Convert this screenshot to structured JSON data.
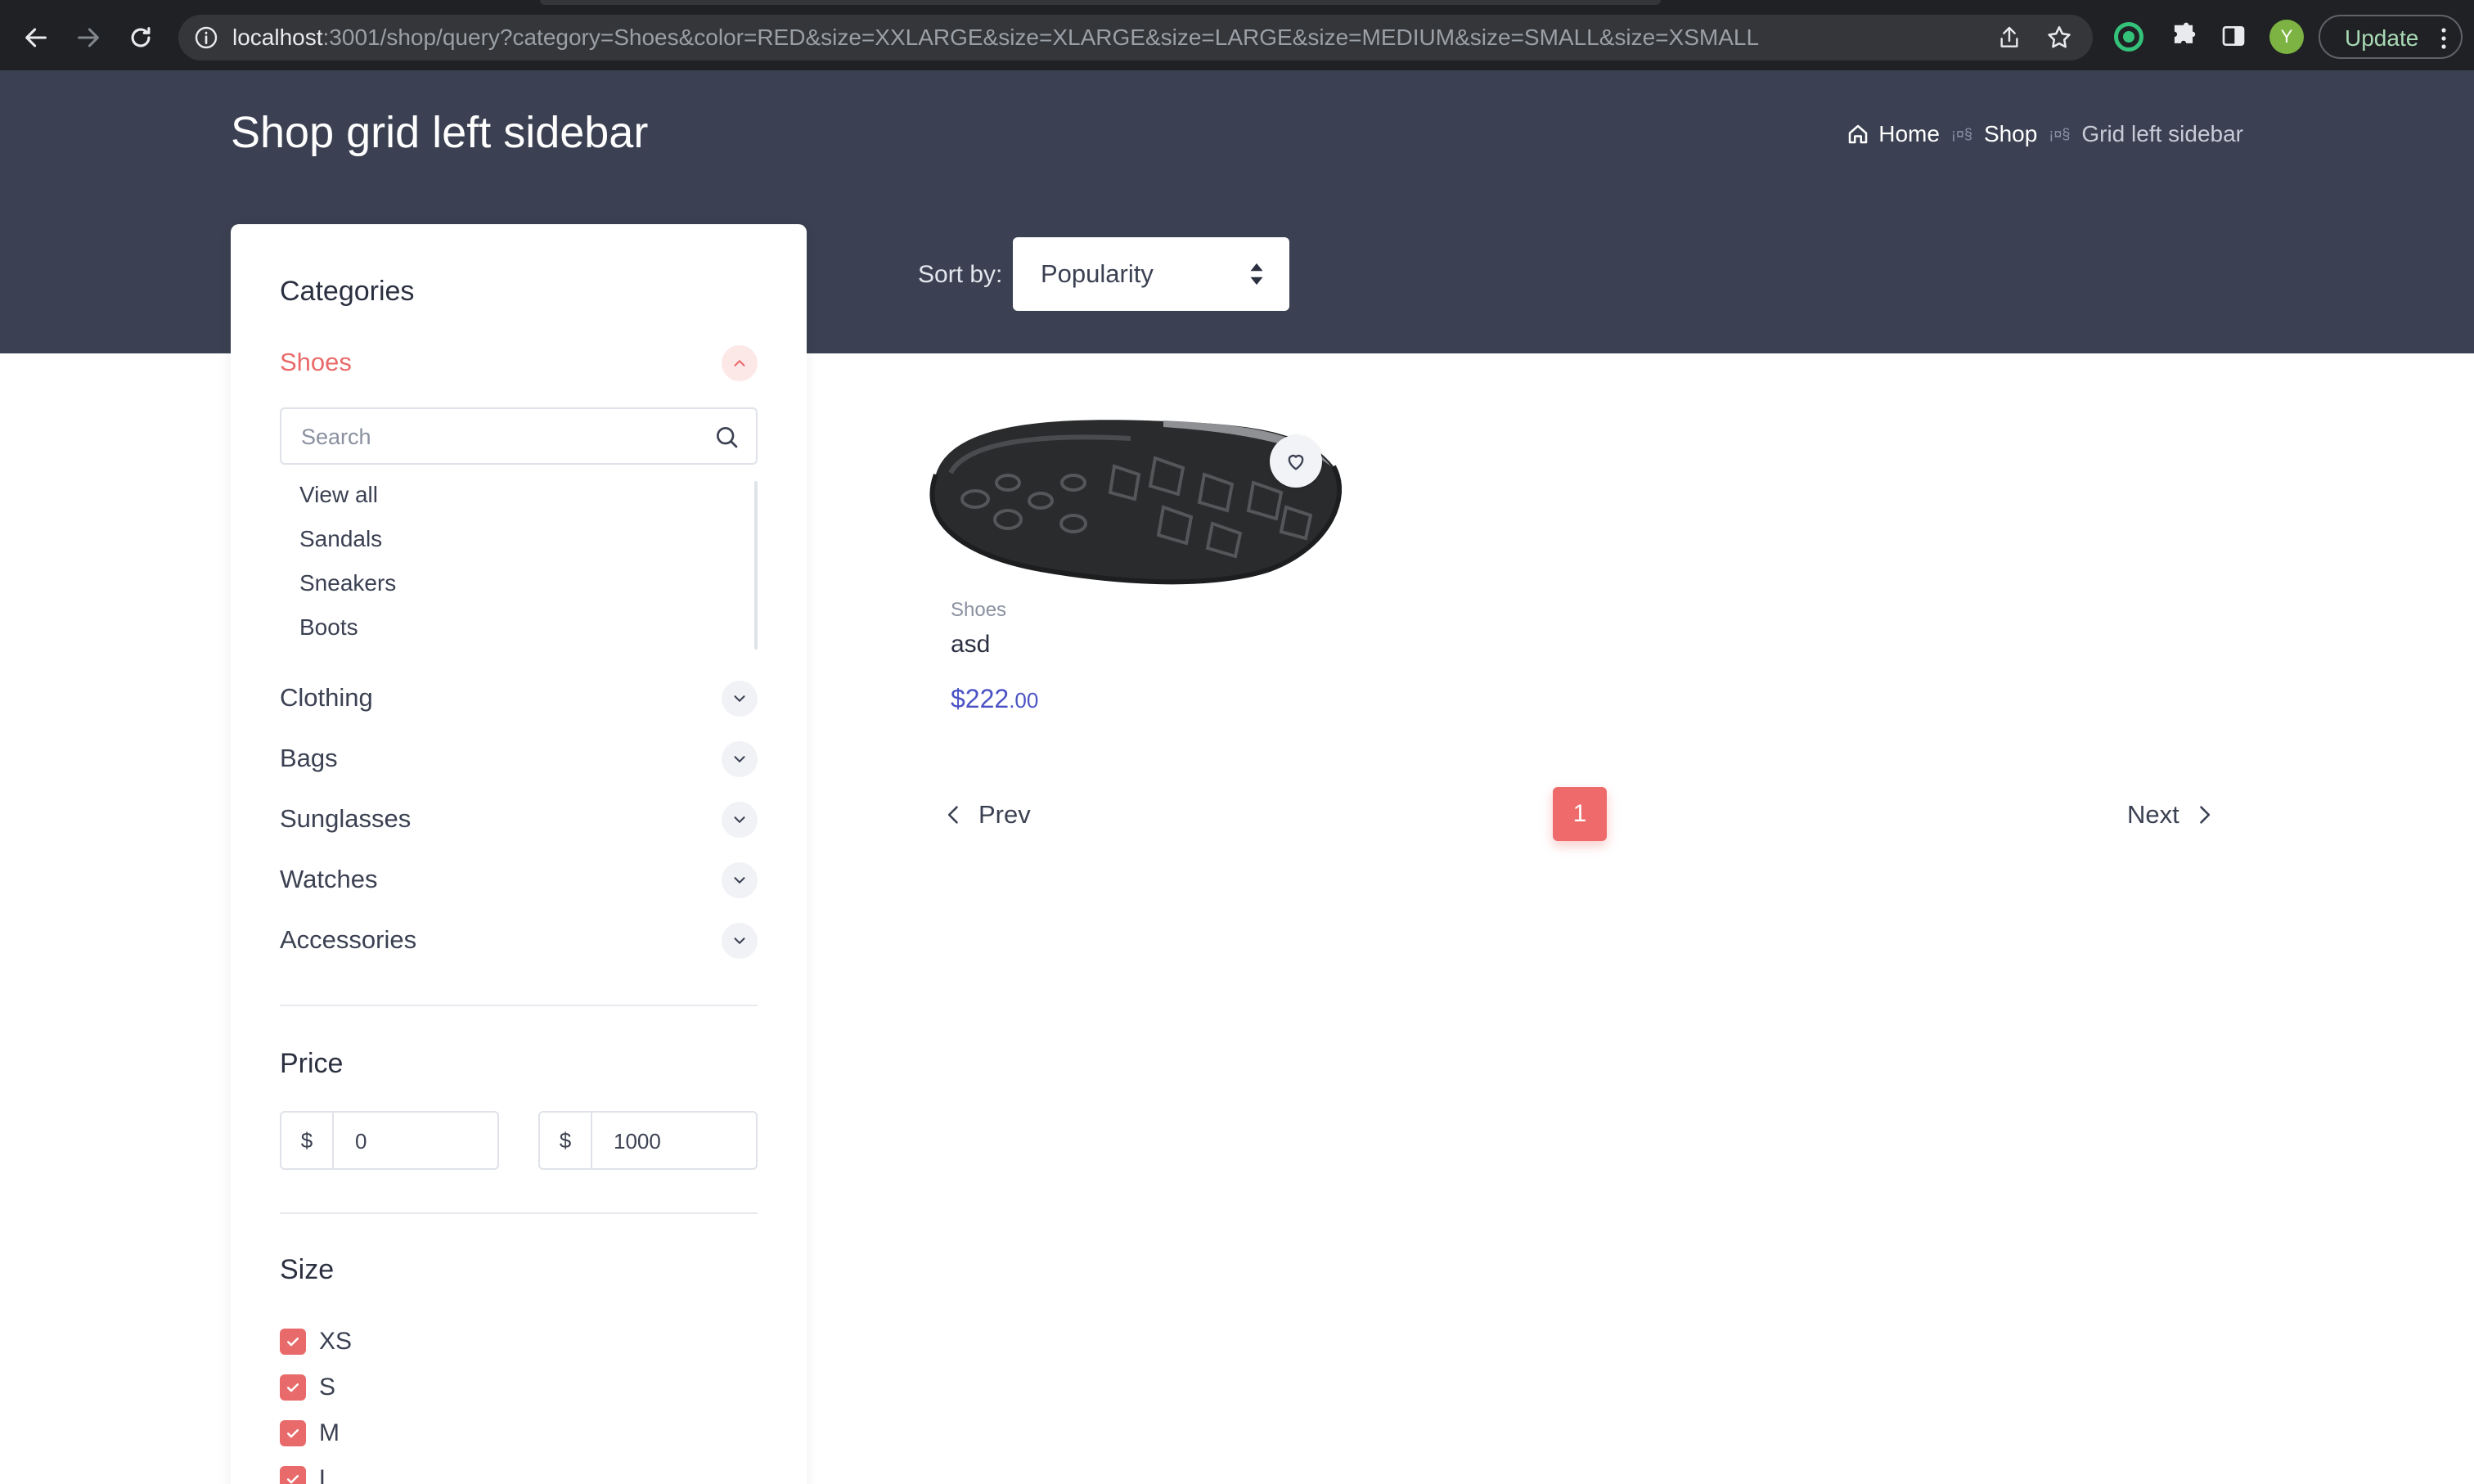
{
  "browser": {
    "url_host": "localhost",
    "url_rest": ":3001/shop/query?category=Shoes&color=RED&size=XXLARGE&size=XLARGE&size=LARGE&size=MEDIUM&size=SMALL&size=XSMALL",
    "profile_initial": "Y",
    "update_label": "Update",
    "icons": [
      "back-icon",
      "forward-icon",
      "reload-icon",
      "info-icon",
      "share-icon",
      "star-icon",
      "extension-icon",
      "puzzle-icon",
      "side-panel-icon",
      "menu-dots-icon"
    ]
  },
  "header": {
    "title": "Shop grid left sidebar",
    "breadcrumb": {
      "home": "Home",
      "separator": "¡¤§",
      "shop": "Shop",
      "current": "Grid left sidebar"
    },
    "sort_label": "Sort by:",
    "sort_value": "Popularity"
  },
  "sidebar": {
    "categories_title": "Categories",
    "categories": [
      {
        "label": "Shoes",
        "expanded": true
      },
      {
        "label": "Clothing",
        "expanded": false
      },
      {
        "label": "Bags",
        "expanded": false
      },
      {
        "label": "Sunglasses",
        "expanded": false
      },
      {
        "label": "Watches",
        "expanded": false
      },
      {
        "label": "Accessories",
        "expanded": false
      }
    ],
    "search_placeholder": "Search",
    "subcategories": [
      "View all",
      "Sandals",
      "Sneakers",
      "Boots"
    ],
    "price_title": "Price",
    "price_currency": "$",
    "price_min": "0",
    "price_max": "1000",
    "size_title": "Size",
    "sizes": [
      {
        "label": "XS",
        "checked": true
      },
      {
        "label": "S",
        "checked": true
      },
      {
        "label": "M",
        "checked": true
      },
      {
        "label": "L",
        "checked": true
      }
    ]
  },
  "products": [
    {
      "category": "Shoes",
      "name": "asd",
      "price_main": "$222",
      "price_cents": ".00"
    }
  ],
  "pagination": {
    "prev": "Prev",
    "next": "Next",
    "current_page": "1"
  },
  "colors": {
    "accent": "#ef6b6b",
    "header_band": "#3b4152",
    "price": "#4b53c4"
  }
}
